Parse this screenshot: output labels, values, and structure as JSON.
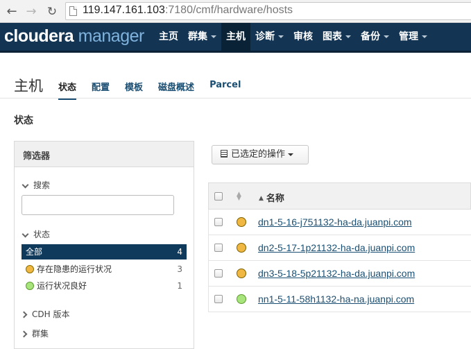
{
  "browser": {
    "url_host": "119.147.161.103",
    "url_rest": ":7180/cmf/hardware/hosts"
  },
  "app": {
    "logo_part1": "cloudera",
    "logo_part2": "manager",
    "menu": [
      {
        "label": "主页",
        "dropdown": false,
        "active": false
      },
      {
        "label": "群集",
        "dropdown": true,
        "active": false
      },
      {
        "label": "主机",
        "dropdown": false,
        "active": true
      },
      {
        "label": "诊断",
        "dropdown": true,
        "active": false
      },
      {
        "label": "审核",
        "dropdown": false,
        "active": false
      },
      {
        "label": "图表",
        "dropdown": true,
        "active": false
      },
      {
        "label": "备份",
        "dropdown": true,
        "active": false
      },
      {
        "label": "管理",
        "dropdown": true,
        "active": false
      }
    ]
  },
  "page": {
    "title": "主机",
    "tabs": [
      "状态",
      "配置",
      "模板",
      "磁盘概述",
      "Parcel"
    ],
    "section_title": "状态"
  },
  "filters": {
    "header": "筛选器",
    "search_label": "搜索",
    "search_value": "",
    "status_label": "状态",
    "status_items": [
      {
        "label": "全部",
        "count": "4",
        "dot": ""
      },
      {
        "label": "存在隐患的运行状况",
        "count": "3",
        "dot": "warn"
      },
      {
        "label": "运行状况良好",
        "count": "1",
        "dot": "good"
      }
    ],
    "cdh_label": "CDH 版本",
    "cluster_label": "群集"
  },
  "actions": {
    "selected_label": "已选定的操作"
  },
  "table": {
    "name_header": "名称",
    "rows": [
      {
        "host": "dn1-5-16-j751132-ha-da.juanpi.com",
        "status": "warn"
      },
      {
        "host": "dn2-5-17-1p21132-ha-da.juanpi.com",
        "status": "warn"
      },
      {
        "host": "dn3-5-18-5p21132-ha-da.juanpi.com",
        "status": "warn"
      },
      {
        "host": "nn1-5-11-58h1132-ha-na.juanpi.com",
        "status": "good"
      }
    ]
  },
  "colors": {
    "navbar": "#133553",
    "accent": "#1a4f73",
    "warn": "#f0b742",
    "good": "#a7e47c"
  }
}
